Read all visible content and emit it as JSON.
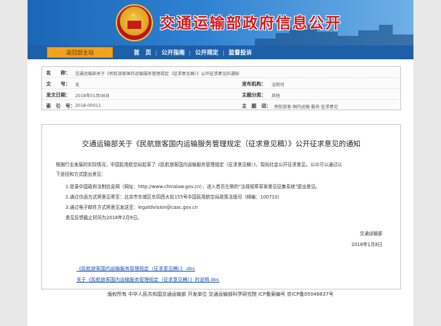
{
  "site": {
    "title": "交通运输部政府信息公开",
    "home_label": "返回部主站"
  },
  "nav": [
    "首　页",
    "公开指南",
    "公开规定",
    "监督投诉"
  ],
  "meta": {
    "name_label": "名　　称：",
    "name_value": "交通运输部关于《民航旅客国内运输服务管理规定（征求意见稿）》公开征求意见的通知",
    "doc_no_label": "文　　号：",
    "doc_no_value": "无",
    "issuer_label": "发布机构：",
    "issuer_value": "法制司",
    "date_label": "发文日期：",
    "date_value": "2018年01月08日",
    "category_label": "主题分类：",
    "category_value": "其他",
    "index_label": "索　引　号：",
    "index_value": "2018-00011",
    "keywords_label": "主　题　词：",
    "keywords_value": "民航旅客·国内运输·服务·征求意见"
  },
  "doc": {
    "title": "交通运输部关于《民航旅客国内运输服务管理规定（征求意见稿）》公开征求意见的通知",
    "intro_1": "根据行业发展的实际情况，中国民用航空局起草了《民航旅客国内运输服务管理规定（征求意见稿）》，现向社会公开征求意见。公众可以通过以",
    "intro_2": "下途径和方式提出意见：",
    "item_1": "1.登录中国政府法制信息网（网址：http://www.chinalaw.gov.cn），进入首页左侧的\"法规规章草案意见征集系统\"提出意见。",
    "item_2": "2.通过信函方式将意见寄至：北京市东城区东四西大街155号中国民用航空局政策法规司（邮编：100710）",
    "item_3": "3.通过电子邮件方式将意见发送至：legaldivision@caac.gov.cn",
    "deadline": "意见反馈截止时间为2018年2月9日。",
    "signature": "交通运输部",
    "sign_date": "2018年1月8日",
    "attachment_1": "《民航旅客国内运输服务管理规定（征求意见稿）》.doc",
    "attachment_2": "关于《民航旅客国内运输服务管理规定（征求意见稿）》的说明.doc"
  },
  "footer": {
    "text": "版权所有  中华人民共和国交通运输部  开发单位  交通运输部科学研究院  ICP备案编号  京ICP备05046837号"
  }
}
